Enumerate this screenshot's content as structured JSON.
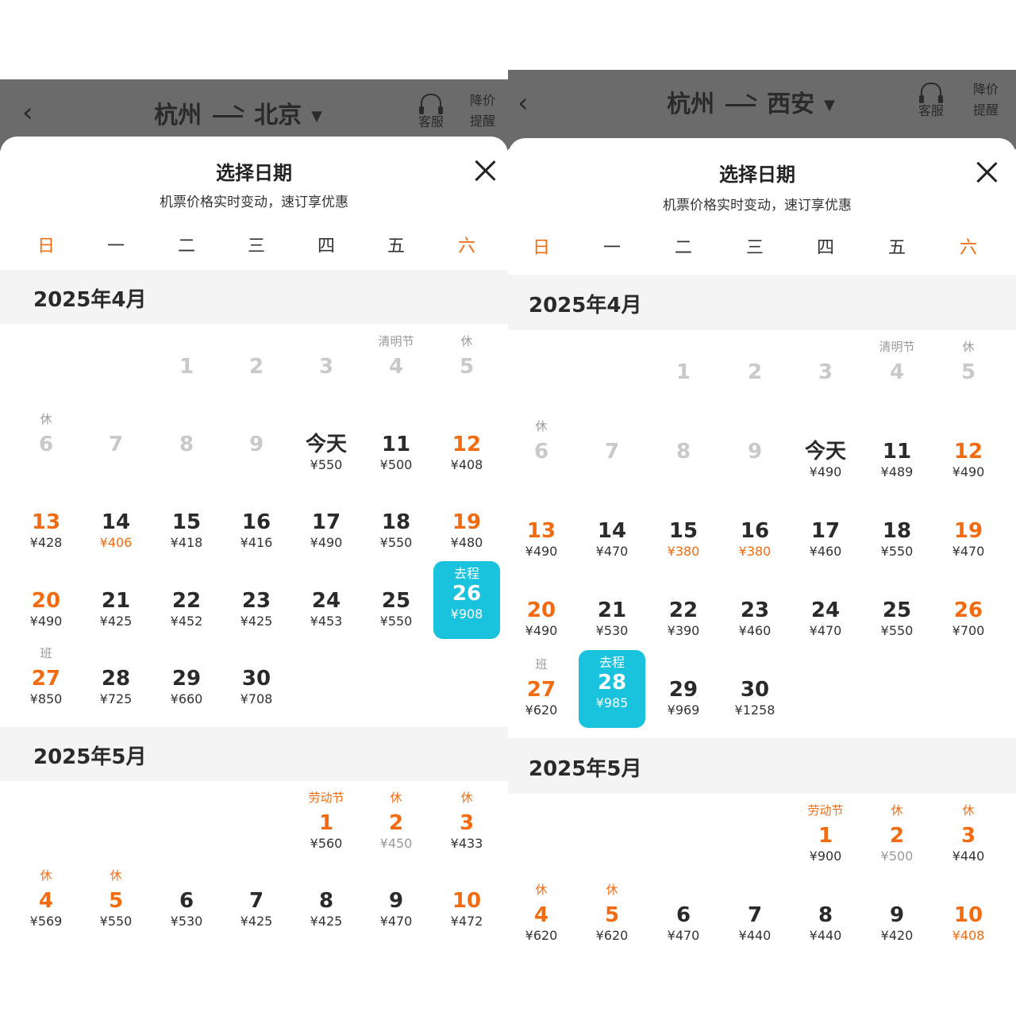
{
  "left": {
    "header": {
      "from": "杭州",
      "to": "北京",
      "service_label": "客服",
      "alert_top": "降价",
      "alert_bottom": "提醒"
    },
    "sheet": {
      "title": "选择日期",
      "subtitle": "机票价格实时变动，速订享优惠"
    },
    "weekdays": [
      "日",
      "一",
      "二",
      "三",
      "四",
      "五",
      "六"
    ],
    "months": [
      {
        "title": "2025年4月",
        "days": [
          {
            "d": "1",
            "p": ""
          },
          {
            "d": "2",
            "p": ""
          },
          {
            "d": "3",
            "p": ""
          },
          {
            "d": "4",
            "p": "",
            "tag": "清明节"
          },
          {
            "d": "5",
            "p": "",
            "tag": "休"
          },
          {
            "d": "6",
            "p": "",
            "tag": "休"
          },
          {
            "d": "7",
            "p": ""
          },
          {
            "d": "8",
            "p": ""
          },
          {
            "d": "9",
            "p": ""
          },
          {
            "d": "今天",
            "p": "¥550"
          },
          {
            "d": "11",
            "p": "¥500"
          },
          {
            "d": "12",
            "p": "¥408"
          },
          {
            "d": "13",
            "p": "¥428"
          },
          {
            "d": "14",
            "p": "¥406"
          },
          {
            "d": "15",
            "p": "¥418"
          },
          {
            "d": "16",
            "p": "¥416"
          },
          {
            "d": "17",
            "p": "¥490"
          },
          {
            "d": "18",
            "p": "¥550"
          },
          {
            "d": "19",
            "p": "¥480"
          },
          {
            "d": "20",
            "p": "¥490"
          },
          {
            "d": "21",
            "p": "¥425"
          },
          {
            "d": "22",
            "p": "¥452"
          },
          {
            "d": "23",
            "p": "¥425"
          },
          {
            "d": "24",
            "p": "¥453"
          },
          {
            "d": "25",
            "p": "¥550"
          },
          {
            "d": "26",
            "p": "¥908",
            "sel": "去程"
          },
          {
            "d": "27",
            "p": "¥850",
            "tag": "班"
          },
          {
            "d": "28",
            "p": "¥725"
          },
          {
            "d": "29",
            "p": "¥660"
          },
          {
            "d": "30",
            "p": "¥708"
          }
        ]
      },
      {
        "title": "2025年5月",
        "days": [
          {
            "d": "1",
            "p": "¥560",
            "tag": "劳动节"
          },
          {
            "d": "2",
            "p": "¥450",
            "tag": "休"
          },
          {
            "d": "3",
            "p": "¥433",
            "tag": "休"
          },
          {
            "d": "4",
            "p": "¥569",
            "tag": "休"
          },
          {
            "d": "5",
            "p": "¥550",
            "tag": "休"
          },
          {
            "d": "6",
            "p": "¥530"
          },
          {
            "d": "7",
            "p": "¥425"
          },
          {
            "d": "8",
            "p": "¥425"
          },
          {
            "d": "9",
            "p": "¥470"
          },
          {
            "d": "10",
            "p": "¥472"
          }
        ]
      }
    ]
  },
  "right": {
    "header": {
      "from": "杭州",
      "to": "西安",
      "service_label": "客服",
      "alert_top": "降价",
      "alert_bottom": "提醒"
    },
    "sheet": {
      "title": "选择日期",
      "subtitle": "机票价格实时变动，速订享优惠"
    },
    "weekdays": [
      "日",
      "一",
      "二",
      "三",
      "四",
      "五",
      "六"
    ],
    "months": [
      {
        "title": "2025年4月",
        "days": [
          {
            "d": "1",
            "p": ""
          },
          {
            "d": "2",
            "p": ""
          },
          {
            "d": "3",
            "p": ""
          },
          {
            "d": "4",
            "p": "",
            "tag": "清明节"
          },
          {
            "d": "5",
            "p": "",
            "tag": "休"
          },
          {
            "d": "6",
            "p": "",
            "tag": "休"
          },
          {
            "d": "7",
            "p": ""
          },
          {
            "d": "8",
            "p": ""
          },
          {
            "d": "9",
            "p": ""
          },
          {
            "d": "今天",
            "p": "¥490"
          },
          {
            "d": "11",
            "p": "¥489"
          },
          {
            "d": "12",
            "p": "¥490"
          },
          {
            "d": "13",
            "p": "¥490"
          },
          {
            "d": "14",
            "p": "¥470"
          },
          {
            "d": "15",
            "p": "¥380"
          },
          {
            "d": "16",
            "p": "¥380"
          },
          {
            "d": "17",
            "p": "¥460"
          },
          {
            "d": "18",
            "p": "¥550"
          },
          {
            "d": "19",
            "p": "¥470"
          },
          {
            "d": "20",
            "p": "¥490"
          },
          {
            "d": "21",
            "p": "¥530"
          },
          {
            "d": "22",
            "p": "¥390"
          },
          {
            "d": "23",
            "p": "¥460"
          },
          {
            "d": "24",
            "p": "¥470"
          },
          {
            "d": "25",
            "p": "¥550"
          },
          {
            "d": "26",
            "p": "¥700"
          },
          {
            "d": "27",
            "p": "¥620",
            "tag": "班"
          },
          {
            "d": "28",
            "p": "¥985",
            "sel": "去程"
          },
          {
            "d": "29",
            "p": "¥969"
          },
          {
            "d": "30",
            "p": "¥1258"
          }
        ]
      },
      {
        "title": "2025年5月",
        "days": [
          {
            "d": "1",
            "p": "¥900",
            "tag": "劳动节"
          },
          {
            "d": "2",
            "p": "¥500",
            "tag": "休"
          },
          {
            "d": "3",
            "p": "¥440",
            "tag": "休"
          },
          {
            "d": "4",
            "p": "¥620",
            "tag": "休"
          },
          {
            "d": "5",
            "p": "¥620",
            "tag": "休"
          },
          {
            "d": "6",
            "p": "¥470"
          },
          {
            "d": "7",
            "p": "¥440"
          },
          {
            "d": "8",
            "p": "¥440"
          },
          {
            "d": "9",
            "p": "¥420"
          },
          {
            "d": "10",
            "p": "¥408"
          }
        ]
      }
    ]
  }
}
